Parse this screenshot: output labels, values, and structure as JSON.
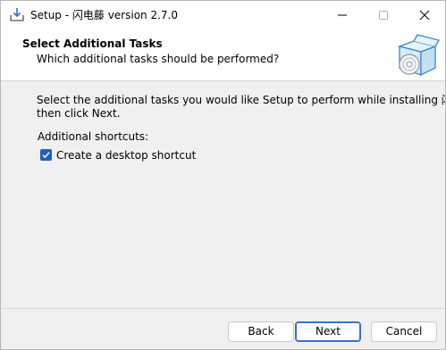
{
  "window": {
    "title": "Setup - 闪电藤 version 2.7.0"
  },
  "header": {
    "title": "Select Additional Tasks",
    "subtitle": "Which additional tasks should be performed?"
  },
  "body": {
    "description_line1": "Select the additional tasks you would like Setup to perform while installing 闪电藤,",
    "description_line2": "then click Next.",
    "group_label": "Additional shortcuts:",
    "tasks": [
      {
        "label": "Create a desktop shortcut",
        "checked": true
      }
    ]
  },
  "buttons": {
    "back": "Back",
    "next": "Next",
    "cancel": "Cancel"
  },
  "icons": {
    "app": "setup-download-icon",
    "header": "installer-box-disc-icon",
    "minimize": "minimize-icon",
    "maximize": "maximize-icon",
    "close": "close-icon",
    "check": "checkmark-icon"
  },
  "colors": {
    "accent": "#1f5fbf",
    "background": "#f0f0f0",
    "header_bg": "#ffffff"
  }
}
